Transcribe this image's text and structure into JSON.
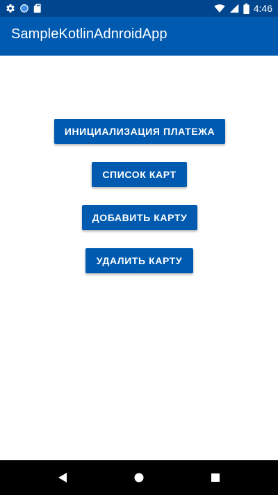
{
  "status_bar": {
    "time": "4:46",
    "left_icons": [
      "settings-icon",
      "circle-icon",
      "sd-card-icon"
    ],
    "right_icons": [
      "wifi-icon",
      "cellular-signal-icon",
      "battery-icon"
    ]
  },
  "app_bar": {
    "title": "SampleKotlinAdnroidApp"
  },
  "buttons": {
    "init_payment": "ИНИЦИАЛИЗАЦИЯ ПЛАТЕЖА",
    "card_list": "СПИСОК КАРТ",
    "add_card": "ДОБАВИТЬ КАРТУ",
    "delete_card": "УДАЛИТЬ КАРТУ"
  },
  "nav_bar": {
    "icons": [
      "back-icon",
      "home-icon",
      "recents-icon"
    ]
  },
  "colors": {
    "status_bar": "#00468f",
    "app_bar": "#005bb0",
    "button": "#005bb0",
    "nav_bar": "#000000",
    "background": "#ffffff"
  }
}
